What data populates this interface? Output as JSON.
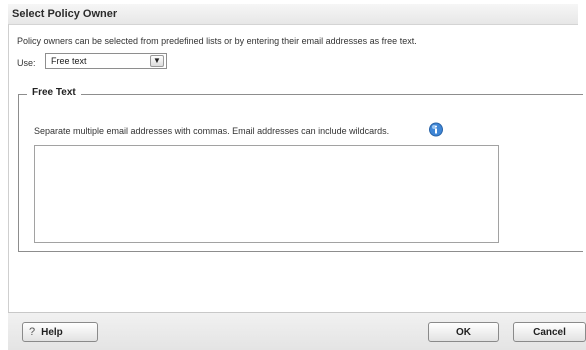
{
  "dialog": {
    "title": "Select Policy Owner",
    "intro": "Policy owners can be selected from predefined lists or by entering their email addresses as free text."
  },
  "use": {
    "label": "Use:",
    "selected": "Free text"
  },
  "free_text": {
    "legend": "Free Text",
    "hint": "Separate multiple email addresses with commas. Email addresses can include wildcards.",
    "value": ""
  },
  "footer": {
    "help_glyph": "?",
    "help_label": "Help",
    "ok_label": "OK",
    "cancel_label": "Cancel"
  },
  "icons": {
    "info": "info-icon",
    "dropdown": "chevron-down-icon",
    "help": "question-icon"
  },
  "colors": {
    "info_icon": "#3f86d6",
    "border": "#8d8d8d"
  }
}
